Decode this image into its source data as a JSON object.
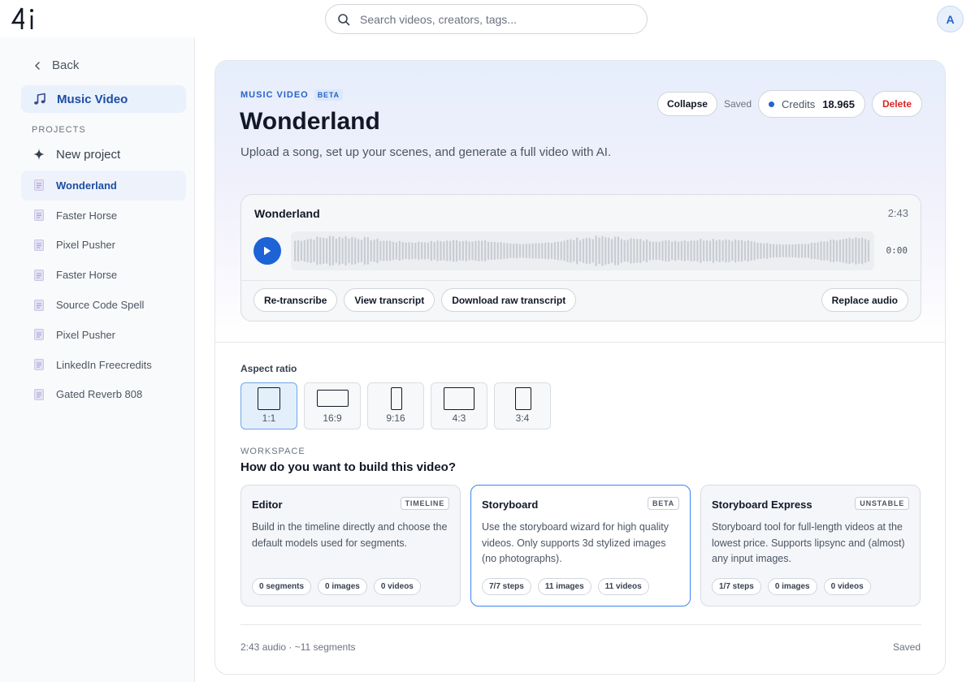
{
  "brand": {
    "logo_text": "4i"
  },
  "search": {
    "placeholder": "Search videos, creators, tags..."
  },
  "user": {
    "avatar_initial": "A"
  },
  "sidebar": {
    "back_label": "Back",
    "section_label": "Music Video",
    "section_icon": "music-note-icon",
    "projects_heading": "PROJECTS",
    "new_project_label": "New project",
    "projects": [
      {
        "label": "Wonderland",
        "active": true
      },
      {
        "label": "Faster Horse"
      },
      {
        "label": "Pixel Pusher"
      },
      {
        "label": "Faster Horse"
      },
      {
        "label": "Source Code Spell"
      },
      {
        "label": "Pixel Pusher"
      },
      {
        "label": "LinkedIn Freecredits"
      },
      {
        "label": "Gated Reverb 808"
      }
    ]
  },
  "header": {
    "eyebrow": "MUSIC VIDEO",
    "beta_badge": "BETA",
    "title": "Wonderland",
    "subtitle": "Upload a song, set up your scenes, and generate a full video with AI.",
    "collapse_label": "Collapse",
    "saved_label": "Saved",
    "credits_label": "Credits",
    "credits_value": "18.965",
    "delete_label": "Delete"
  },
  "audio": {
    "track_name": "Wonderland",
    "duration": "2:43",
    "timecode": "0:00",
    "actions": [
      "Re-transcribe",
      "View transcript",
      "Download raw transcript"
    ],
    "replace_label": "Replace audio"
  },
  "aspect_ratio": {
    "label": "Aspect ratio",
    "selected": "1:1",
    "options": [
      "1:1",
      "16:9",
      "9:16",
      "4:3",
      "3:4"
    ]
  },
  "workspace": {
    "eyebrow": "WORKSPACE",
    "title": "How do you want to build this video?",
    "options": [
      {
        "name": "Editor",
        "tag": "TIMELINE",
        "description": "Build in the timeline directly and choose the default models used for segments.",
        "chips": [
          "0 segments",
          "0 images",
          "0 videos"
        ],
        "selected": false
      },
      {
        "name": "Storyboard",
        "tag": "BETA",
        "description": "Use the storyboard wizard for high quality videos. Only supports 3d stylized images (no photographs).",
        "chips": [
          "7/7 steps",
          "11 images",
          "11 videos"
        ],
        "selected": true
      },
      {
        "name": "Storyboard Express",
        "tag": "UNSTABLE",
        "description": "Storyboard tool for full-length videos at the lowest price. Supports lipsync and (almost) any input images.",
        "chips": [
          "1/7 steps",
          "0 images",
          "0 videos"
        ],
        "selected": false
      }
    ]
  },
  "footer": {
    "summary": "2:43 audio · ~11 segments",
    "status": "Saved"
  },
  "colors": {
    "accent": "#1d63d6",
    "danger": "#dc2626",
    "selected_bg": "#e3f0fc"
  }
}
